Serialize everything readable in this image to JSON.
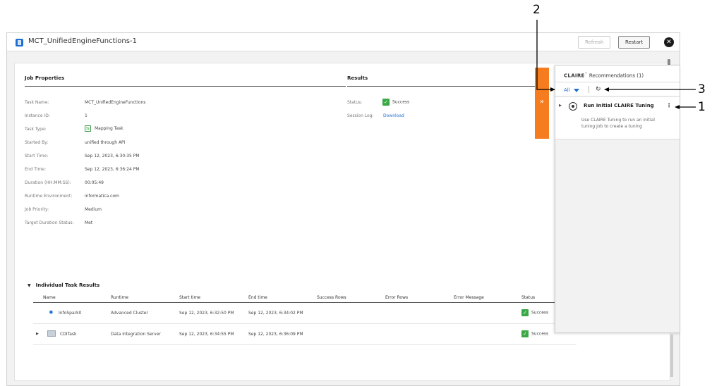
{
  "window": {
    "title": "MCT_UnifiedEngineFunctions-1",
    "refresh_label": "Refresh",
    "restart_label": "Restart",
    "close_symbol": "✕"
  },
  "job_properties": {
    "title": "Job Properties",
    "rows": [
      {
        "label": "Task Name:",
        "value": "MCT_UnifiedEngineFunctions"
      },
      {
        "label": "Instance ID:",
        "value": "1"
      },
      {
        "label": "Task Type:",
        "value": "Mapping Task"
      },
      {
        "label": "Started By:",
        "value": "unified through API"
      },
      {
        "label": "Start Time:",
        "value": "Sep 12, 2023, 6:30:35 PM"
      },
      {
        "label": "End Time:",
        "value": "Sep 12, 2023, 6:36:24 PM"
      },
      {
        "label": "Duration (HH:MM:SS):",
        "value": "00:05:49"
      },
      {
        "label": "Runtime Environment:",
        "value": "informatica.com"
      },
      {
        "label": "Job Priority:",
        "value": "Medium"
      },
      {
        "label": "Target Duration Status:",
        "value": "Met"
      }
    ]
  },
  "results": {
    "title": "Results",
    "status_label": "Status:",
    "status_value": "Success",
    "session_log_label": "Session Log:",
    "session_log_link": "Download"
  },
  "task_results": {
    "title": "Individual Task Results",
    "columns": [
      "Name",
      "Runtime",
      "Start time",
      "End time",
      "Success Rows",
      "Error Rows",
      "Error Message",
      "Status"
    ],
    "rows": [
      {
        "name": "InfoSpark0",
        "runtime": "Advanced Cluster",
        "start": "Sep 12, 2023, 6:32:50 PM",
        "end": "Sep 12, 2023, 6:34:02 PM",
        "status": "Success"
      },
      {
        "name": "CDITask",
        "runtime": "Data Integration Server",
        "start": "Sep 12, 2023, 6:34:55 PM",
        "end": "Sep 12, 2023, 6:36:09 PM",
        "status": "Success"
      }
    ]
  },
  "claire_panel": {
    "brand": "CLAIRE",
    "tm": "™",
    "header_rest": "Recommendations (1)",
    "filter_label": "All",
    "recommendation": {
      "title": "Run Initial CLAIRE Tuning",
      "description": "Use CLAIRE Tuning to run an initial tuning job to create a tuning"
    },
    "expand_symbol": "»"
  },
  "callouts": [
    "1",
    "2",
    "3"
  ]
}
